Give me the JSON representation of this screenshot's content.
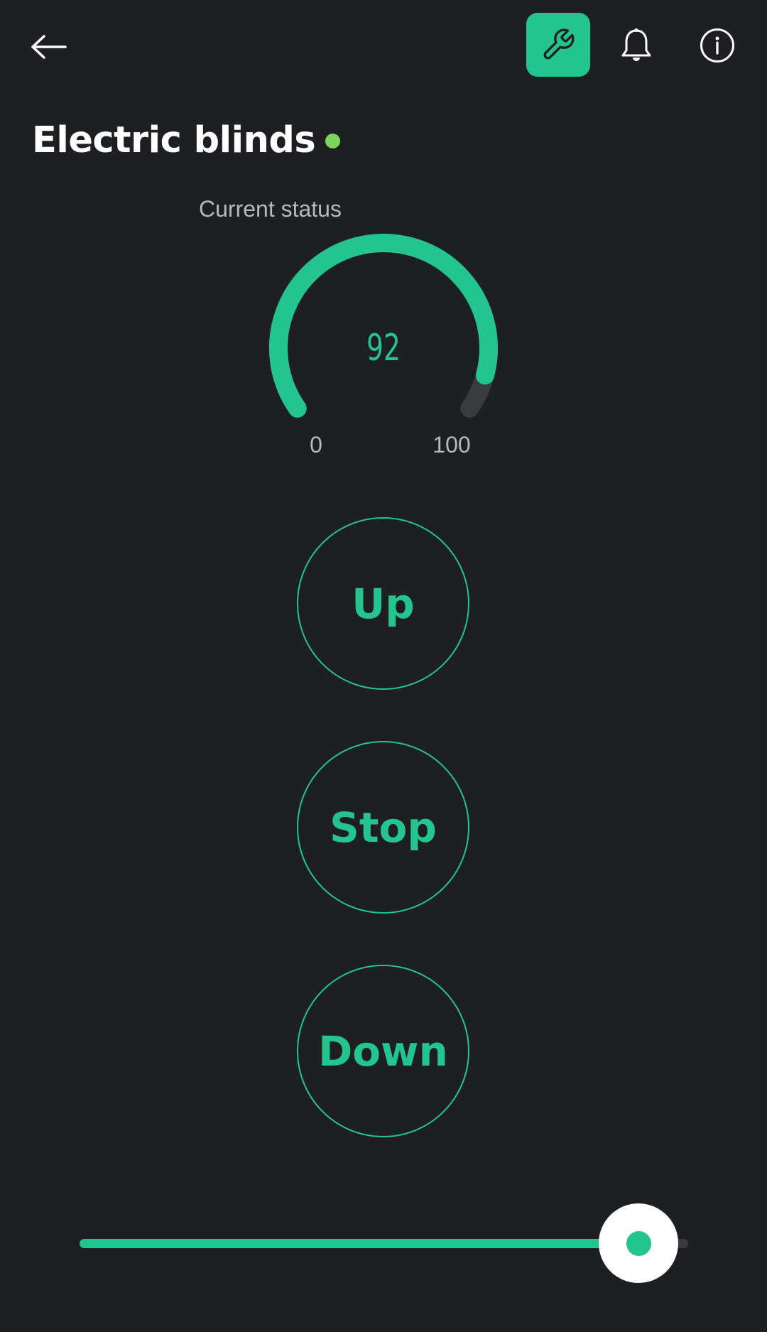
{
  "colors": {
    "accent": "#23c48e",
    "status_online": "#7ed35a",
    "background": "#1e1f22",
    "track": "#3a3b3f",
    "muted_text": "#b5b8bd"
  },
  "header": {
    "back_icon": "arrow-left-icon",
    "settings_icon": "wrench-icon",
    "notifications_icon": "bell-icon",
    "info_icon": "info-icon"
  },
  "device": {
    "title": "Electric blinds",
    "status": "online"
  },
  "gauge": {
    "label": "Current status",
    "value": "92",
    "value_number": 92,
    "min": "0",
    "max": "100"
  },
  "buttons": {
    "up": "Up",
    "stop": "Stop",
    "down": "Down"
  },
  "slider": {
    "value_fraction": 0.92
  }
}
